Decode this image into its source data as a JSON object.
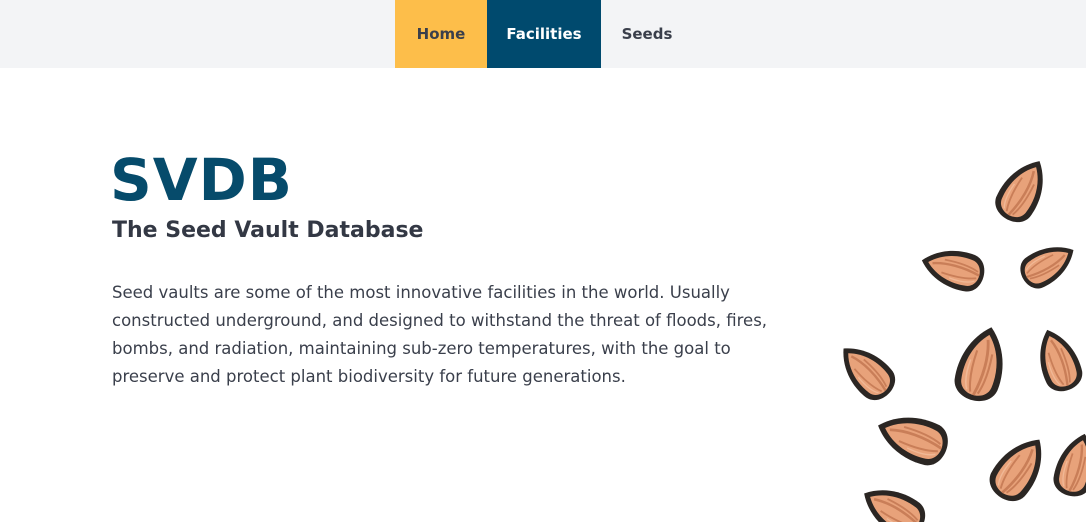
{
  "nav": {
    "items": [
      {
        "label": "Home",
        "color": "#fdbe4a"
      },
      {
        "label": "Facilities",
        "color": "#004a6e"
      },
      {
        "label": "Seeds",
        "color": "#f3f4f6"
      }
    ]
  },
  "hero": {
    "title": "SVDB",
    "subtitle": "The Seed Vault Database",
    "description": "Seed vaults are some of the most innovative facilities in the world. Usually constructed underground, and designed to withstand the threat of floods, fires, bombs, and radiation, maintaining sub-zero temperatures, with the goal to preserve and protect plant biodiversity for future generations."
  },
  "illustration": {
    "icon": "seeds-illustration-icon",
    "colors": {
      "outline": "#2b2623",
      "fill": "#e8a27a",
      "stripe": "#c97e58"
    }
  }
}
